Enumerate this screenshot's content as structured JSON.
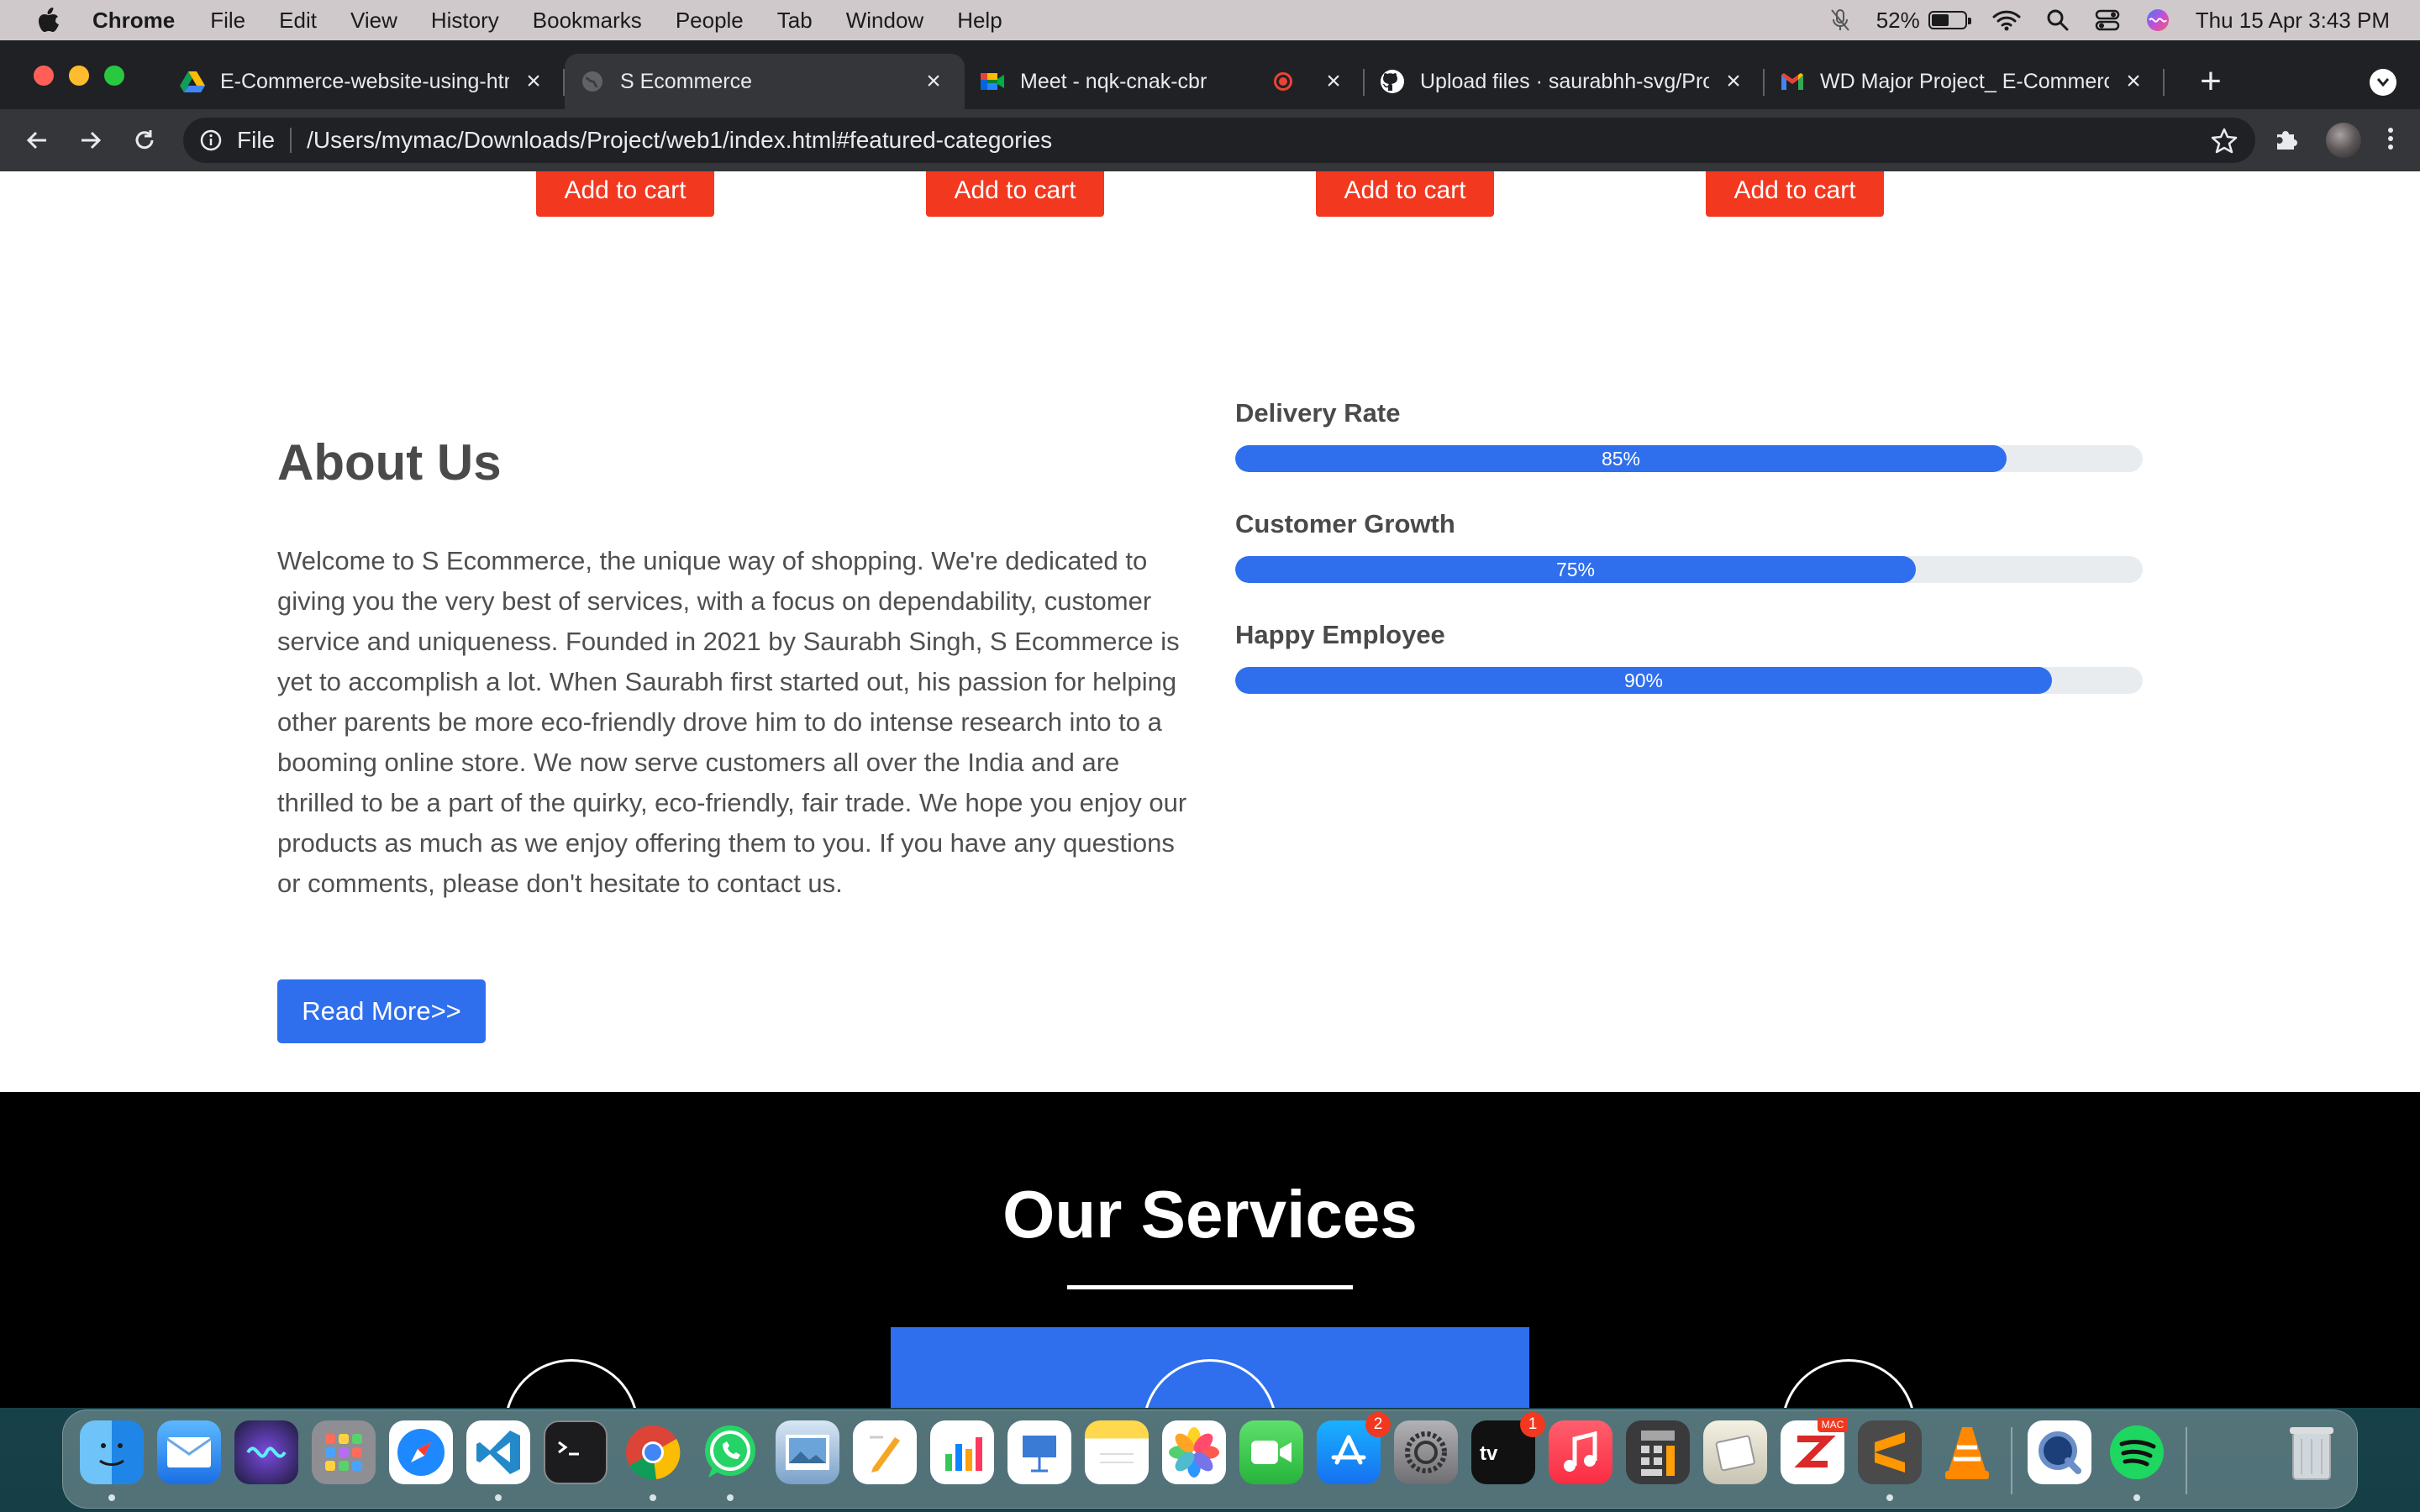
{
  "menubar": {
    "app_name": "Chrome",
    "items": [
      "File",
      "Edit",
      "View",
      "History",
      "Bookmarks",
      "People",
      "Tab",
      "Window",
      "Help"
    ],
    "battery_percent": "52%",
    "battery_level": 0.52,
    "datetime": "Thu 15 Apr  3:43 PM"
  },
  "browser": {
    "tabs": [
      {
        "title": "E-Commerce-website-using-htm",
        "icon": "google-drive-icon",
        "active": false
      },
      {
        "title": "S Ecommerce",
        "icon": "globe-icon",
        "active": true
      },
      {
        "title": "Meet - nqk-cnak-cbr",
        "icon": "google-meet-icon",
        "active": false,
        "recording": true
      },
      {
        "title": "Upload files · saurabhh-svg/Pro",
        "icon": "github-icon",
        "active": false
      },
      {
        "title": "WD Major Project_ E-Commerce",
        "icon": "gmail-icon",
        "active": false
      }
    ],
    "address": {
      "scheme_label": "File",
      "url": "/Users/mymac/Downloads/Project/web1/index.html#featured-categories"
    }
  },
  "page": {
    "add_to_cart_label": "Add to cart",
    "about": {
      "title": "About Us",
      "text": "Welcome to S Ecommerce, the unique way of shopping. We're dedicated to giving you the very best of services, with a focus on dependability, customer service and uniqueness. Founded in 2021 by Saurabh Singh, S Ecommerce is yet to accomplish a lot. When Saurabh first started out, his passion for helping other parents be more eco-friendly drove him to do intense research into to a booming online store. We now serve customers all over the India and are thrilled to be a part of the quirky, eco-friendly, fair trade. We hope you enjoy our products as much as we enjoy offering them to you. If you have any questions or comments, please don't hesitate to contact us.",
      "read_more_label": "Read More>>"
    },
    "skills": [
      {
        "label": "Delivery Rate",
        "percent_label": "85%",
        "value": 85
      },
      {
        "label": "Customer Growth",
        "percent_label": "75%",
        "value": 75
      },
      {
        "label": "Happy Employee",
        "percent_label": "90%",
        "value": 90
      }
    ],
    "services": {
      "title": "Our Services"
    },
    "colors": {
      "accent_blue": "#2f6fee",
      "cart_red": "#f2381f"
    }
  },
  "dock": {
    "apps": [
      "finder-icon",
      "mail-icon",
      "siri-icon",
      "launchpad-icon",
      "safari-icon",
      "vscode-icon",
      "terminal-icon",
      "chrome-icon",
      "whatsapp-icon",
      "preview-icon",
      "pages-icon",
      "numbers-icon",
      "keynote-icon",
      "notes-icon",
      "photos-icon",
      "facetime-icon",
      "app-store-icon",
      "system-preferences-icon",
      "apple-tv-icon",
      "music-icon",
      "calculator-icon",
      "mac-cleaner-icon",
      "zotero-icon",
      "sublime-text-icon",
      "vlc-icon",
      "quicktime-icon",
      "spotify-icon",
      "trash-icon"
    ],
    "app_store_badge": "2",
    "tv_badge": "1",
    "mac_label": "MAC"
  }
}
